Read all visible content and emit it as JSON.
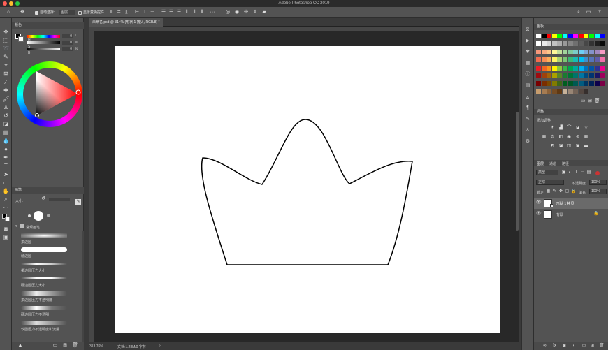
{
  "window": {
    "title": "Adobe Photoshop CC 2019"
  },
  "options_bar": {
    "auto_select_label": "自动选择:",
    "auto_select_value": "图层",
    "show_transform_label": "显示变换控件"
  },
  "document": {
    "tab_label": "未命名.psd @ 314% (形状 1 拷贝, RGB/8) *",
    "zoom": "313.76%",
    "doc_info": "文档:1.28M/0 字节"
  },
  "color_panel": {
    "title": "颜色",
    "sliders": [
      {
        "letter": "H",
        "value": "0",
        "unit": "°"
      },
      {
        "letter": "S",
        "value": "0",
        "unit": "%"
      },
      {
        "letter": "B",
        "value": "0",
        "unit": "%"
      }
    ]
  },
  "brush_panel": {
    "title": "画笔",
    "size_label": "大小:",
    "group_name": "常规画笔",
    "brushes": [
      {
        "name": "柔边圆"
      },
      {
        "name": "硬边圆"
      },
      {
        "name": "柔边圆压力大小"
      },
      {
        "name": "硬边圆压力大小"
      },
      {
        "name": "柔边圆压力不透明度"
      },
      {
        "name": "硬边圆压力不透明"
      },
      {
        "name": "软圆压力不透明度和流量"
      }
    ]
  },
  "swatches_panel": {
    "title": "色板",
    "rows": [
      [
        "#ffffff",
        "#000000",
        "#ff0000",
        "#ffff00",
        "#00ff00",
        "#00ffff",
        "#0000ff",
        "#ff00ff",
        "#ff0000",
        "#ffff00",
        "#00ff00",
        "#00ffff",
        "#0000ff"
      ],
      [
        "#ffffff",
        "#ebebeb",
        "#d6d6d6",
        "#c2c2c2",
        "#adadad",
        "#999999",
        "#858585",
        "#707070",
        "#5c5c5c",
        "#474747",
        "#333333",
        "#1f1f1f",
        "#0a0a0a"
      ],
      [
        "#f7977a",
        "#f9ad81",
        "#fdc68a",
        "#fff79a",
        "#c4df9b",
        "#a2d39c",
        "#82ca9d",
        "#7bcdc8",
        "#6ecff6",
        "#7ea7d8",
        "#8493ca",
        "#a187be",
        "#f49ac2"
      ],
      [
        "#f26c4f",
        "#f68e55",
        "#fbaf5c",
        "#fff467",
        "#acd372",
        "#7cc576",
        "#3bb878",
        "#1abbb4",
        "#00bff3",
        "#438ccb",
        "#5574b9",
        "#605ca8",
        "#f06ea9"
      ],
      [
        "#ed1c24",
        "#f26522",
        "#f7941d",
        "#fff200",
        "#8dc63f",
        "#39b54a",
        "#00a651",
        "#00a99d",
        "#00aeef",
        "#0072bc",
        "#0054a6",
        "#2e3192",
        "#ec008c"
      ],
      [
        "#9e0b0f",
        "#a0410d",
        "#a36209",
        "#aba000",
        "#598527",
        "#1a7b30",
        "#007236",
        "#00746b",
        "#0076a3",
        "#004b80",
        "#003471",
        "#1b1464",
        "#9e005d"
      ],
      [
        "#790000",
        "#7b2e00",
        "#7d4900",
        "#827b00",
        "#406618",
        "#005e20",
        "#005826",
        "#005952",
        "#005b7f",
        "#003663",
        "#002157",
        "#0d004c",
        "#7b0046"
      ],
      [
        "#c69c6d",
        "#a67c52",
        "#8c6239",
        "#754c24",
        "#603913",
        "#c7b299",
        "#998675",
        "#736357",
        "#534741",
        "#362f2d"
      ]
    ]
  },
  "adjustments_panel": {
    "title": "调整",
    "subtitle": "添加调整"
  },
  "layers_panel": {
    "tabs": [
      "图层",
      "通道",
      "路径"
    ],
    "filter_label": "类型",
    "blend_mode": "正常",
    "opacity_label": "不透明度:",
    "opacity_value": "100%",
    "lock_label": "锁定:",
    "fill_label": "填充:",
    "fill_value": "100%",
    "layers": [
      {
        "name": "形状 1 拷贝",
        "selected": true
      },
      {
        "name": "背景",
        "selected": false
      }
    ]
  }
}
